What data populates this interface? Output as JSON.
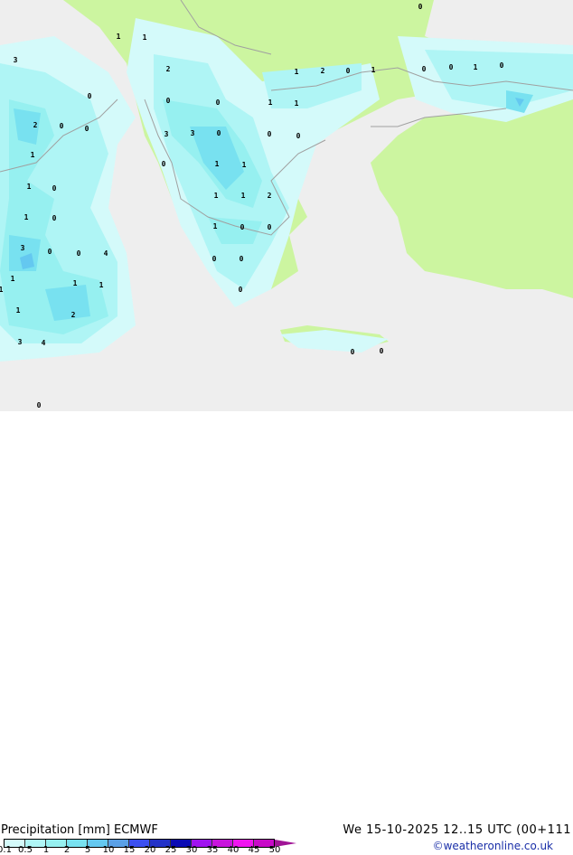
{
  "legend": {
    "title": "Precipitation [mm]  ECMWF",
    "ticks": [
      "0.1",
      "0.5",
      "1",
      "2",
      "5",
      "10",
      "15",
      "20",
      "25",
      "30",
      "35",
      "40",
      "45",
      "50"
    ],
    "colors": [
      "#d4fafa",
      "#aff5f5",
      "#96f0f0",
      "#78e1f0",
      "#64c8f0",
      "#5aa0e6",
      "#3c50f0",
      "#2332c8",
      "#0a0ab4",
      "#a014f0",
      "#c814dc",
      "#f014f0",
      "#c80ac8"
    ],
    "overflow_color": "#a01496"
  },
  "valid_time": "We 15-10-2025 12..15 UTC (00+111",
  "credit": "©weatheronline.co.uk",
  "map": {
    "sea_color": "#eeeeee",
    "land_color": "#ccf5a0",
    "border_color": "#a0a0a0",
    "point_values": [
      "3",
      "0",
      "0",
      "1",
      "1",
      "2",
      "2",
      "0",
      "0",
      "1",
      "1",
      "0",
      "1",
      "0",
      "1",
      "1",
      "3",
      "1",
      "1",
      "1",
      "2",
      "0",
      "0",
      "4",
      "3",
      "4",
      "0",
      "0",
      "0",
      "1",
      "1",
      "1",
      "2",
      "0",
      "1",
      "3",
      "3",
      "0",
      "0",
      "0",
      "0",
      "1",
      "1",
      "1",
      "1",
      "2",
      "1",
      "0",
      "0",
      "0",
      "0",
      "0",
      "0",
      "0",
      "0",
      "0",
      "1",
      "0"
    ]
  }
}
